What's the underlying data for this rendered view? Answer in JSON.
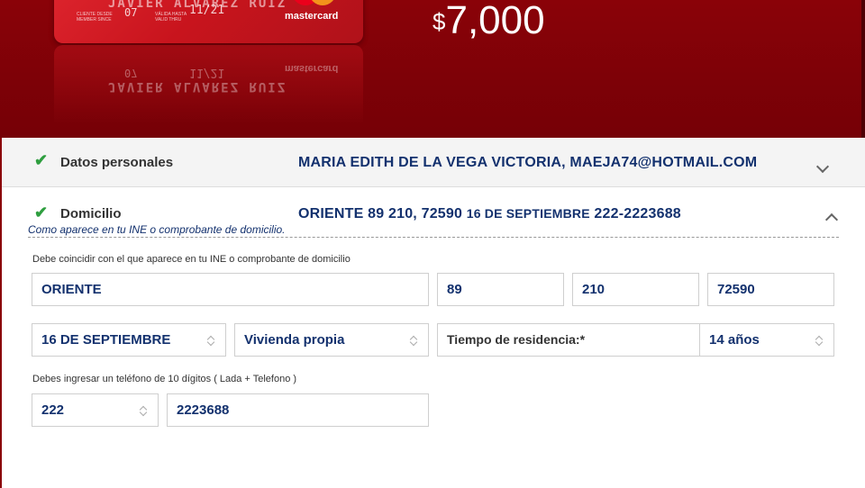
{
  "banner": {
    "card": {
      "holder_name": "JAVIER ALVAREZ RUIZ",
      "member_since_label": "CLIENTE DESDE MEMBER SINCE",
      "member_since_value": "07",
      "valid_thru_label": "VÁLIDA HASTA VALID THRU",
      "valid_thru_value": "11/21",
      "brand": "mastercard"
    },
    "amount_currency": "$",
    "amount_value": "7,000"
  },
  "sections": {
    "personal": {
      "title": "Datos personales",
      "summary": "MARIA EDITH DE LA VEGA VICTORIA, MAEJA74@HOTMAIL.COM"
    },
    "domicilio": {
      "title": "Domicilio",
      "summary_main": "ORIENTE 89 210, 72590 ",
      "summary_small": "16 DE SEPTIEMBRE",
      "summary_phone": " 222-2223688",
      "hint": "Como aparece en tu INE o comprobante de domicilio."
    }
  },
  "form": {
    "address_note": "Debe coincidir con el que aparece en tu INE o comprobante de domicilio",
    "street": "ORIENTE",
    "ext_number": "89",
    "int_number": "210",
    "postal_code": "72590",
    "colonia": "16 DE SEPTIEMBRE",
    "housing_type": "Vivienda propia",
    "residence_label": "Tiempo de residencia:*",
    "residence_value": "14 años",
    "phone_note": "Debes ingresar un teléfono de 10 dígitos ( Lada + Telefono )",
    "lada": "222",
    "phone": "2223688"
  },
  "colors": {
    "banner": "#8a0208",
    "summary_text": "#13316e",
    "check": "#2e9e3f"
  }
}
